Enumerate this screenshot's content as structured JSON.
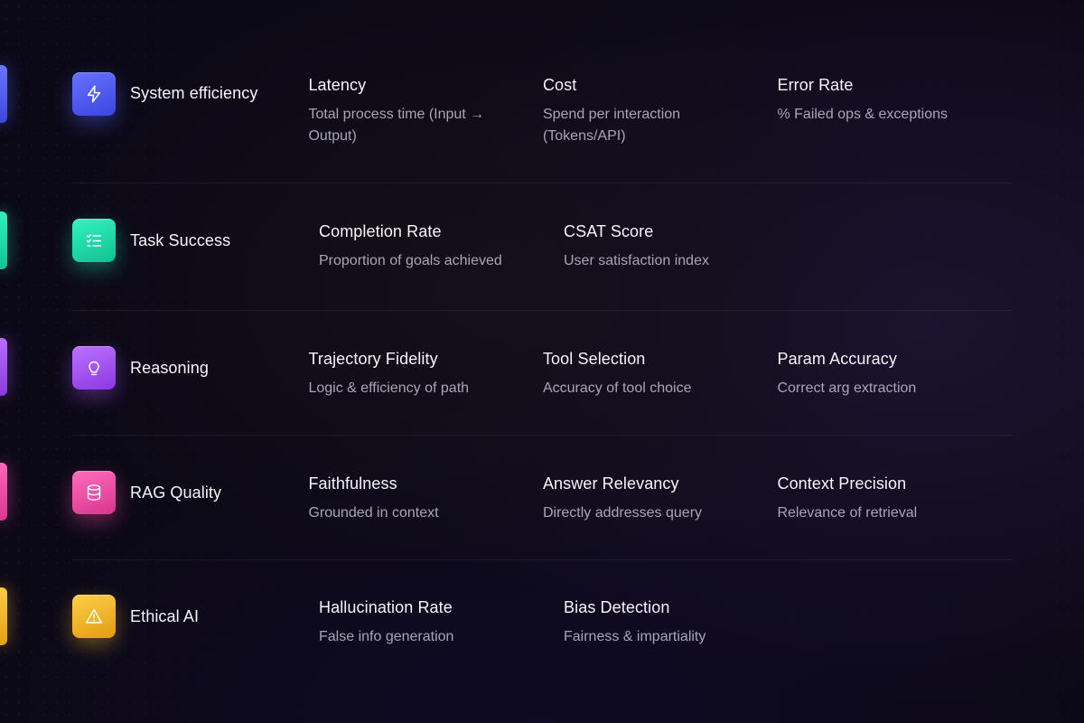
{
  "colors": {
    "system_efficiency": "#4f5ef2",
    "task_success": "#19d9a8",
    "reasoning": "#a04ff0",
    "rag_quality": "#ec4aa4",
    "ethical_ai": "#f0b427"
  },
  "rows": [
    {
      "category": "System efficiency",
      "icon": "lightning-icon",
      "metrics": [
        {
          "title": "Latency",
          "desc": "Total process time (Input → Output)"
        },
        {
          "title": "Cost",
          "desc": "Spend per interaction (Tokens/API)"
        },
        {
          "title": "Error Rate",
          "desc": "% Failed ops & exceptions"
        }
      ]
    },
    {
      "category": "Task Success",
      "icon": "checklist-icon",
      "metrics": [
        {
          "title": "Completion Rate",
          "desc": "Proportion of goals achieved"
        },
        {
          "title": "CSAT Score",
          "desc": "User satisfaction index"
        }
      ]
    },
    {
      "category": "Reasoning",
      "icon": "lightbulb-icon",
      "metrics": [
        {
          "title": "Trajectory Fidelity",
          "desc": "Logic & efficiency of path"
        },
        {
          "title": "Tool Selection",
          "desc": "Accuracy of tool choice"
        },
        {
          "title": "Param Accuracy",
          "desc": "Correct arg extraction"
        }
      ]
    },
    {
      "category": "RAG Quality",
      "icon": "database-icon",
      "metrics": [
        {
          "title": "Faithfulness",
          "desc": "Grounded in context"
        },
        {
          "title": "Answer Relevancy",
          "desc": "Directly addresses query"
        },
        {
          "title": "Context Precision",
          "desc": "Relevance of retrieval"
        }
      ]
    },
    {
      "category": "Ethical AI",
      "icon": "warning-icon",
      "metrics": [
        {
          "title": "Hallucination Rate",
          "desc": "False info generation"
        },
        {
          "title": "Bias Detection",
          "desc": "Fairness & impartiality"
        }
      ]
    }
  ]
}
